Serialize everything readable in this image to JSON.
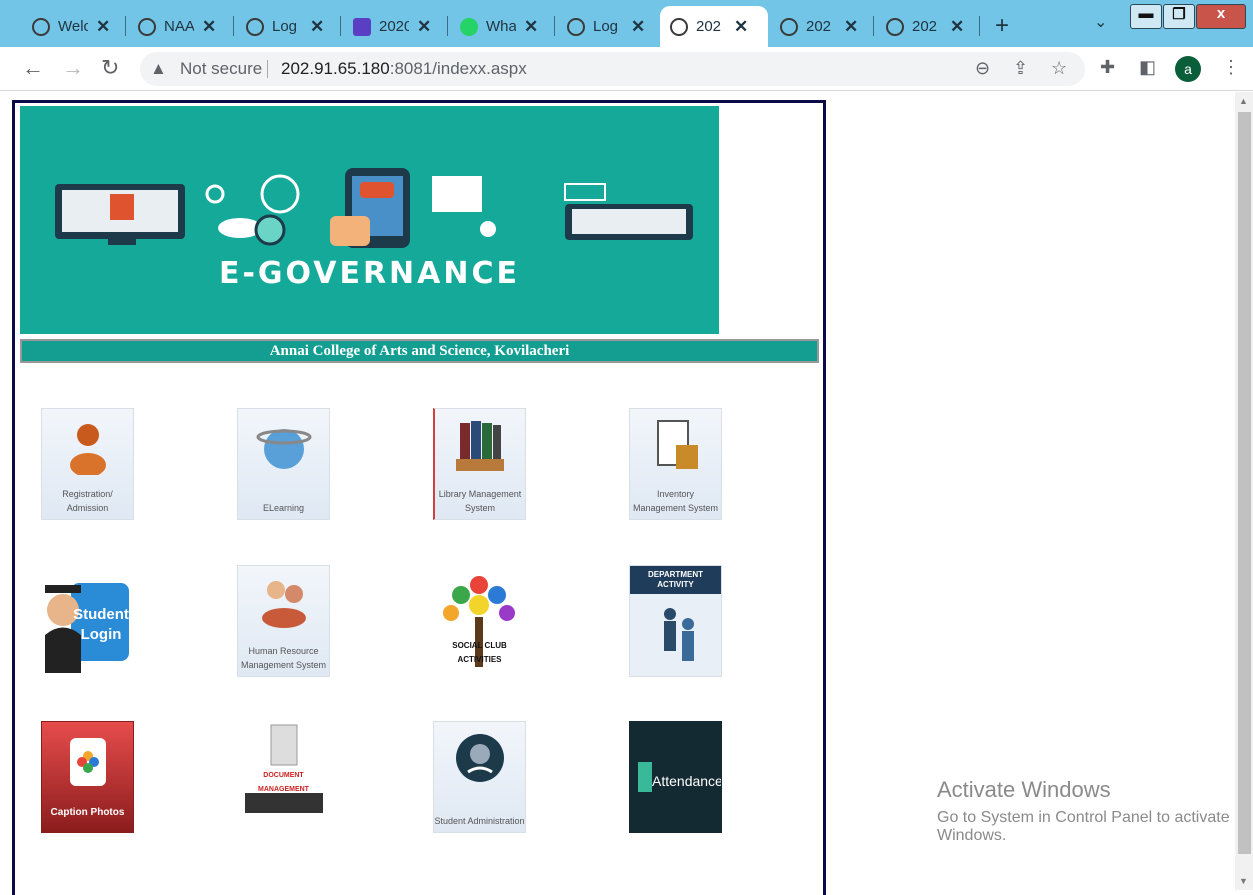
{
  "tabs": [
    {
      "title": "Welc",
      "icon": "globe-icon",
      "active": false
    },
    {
      "title": "NAA",
      "icon": "globe-icon",
      "active": false
    },
    {
      "title": "Log",
      "icon": "globe-icon",
      "active": false
    },
    {
      "title": "2020",
      "icon": "form-icon",
      "active": false
    },
    {
      "title": "Wha",
      "icon": "whatsapp-icon",
      "active": false
    },
    {
      "title": "Log",
      "icon": "globe-icon",
      "active": false
    },
    {
      "title": "202",
      "icon": "globe-icon",
      "active": true
    },
    {
      "title": "202",
      "icon": "globe-icon",
      "active": false
    },
    {
      "title": "202",
      "icon": "globe-icon",
      "active": false
    }
  ],
  "window": {
    "minimize": "▬",
    "restore": "❐",
    "close": "x"
  },
  "toolbar": {
    "not_secure": "Not secure",
    "url_host": "202.91.65.180",
    "url_rest": ":8081/indexx.aspx",
    "avatar_letter": "a"
  },
  "banner": {
    "title": "E-GOVERNANCE"
  },
  "college_name": "Annai College of Arts and Science, Kovilacheri",
  "tiles": [
    {
      "label": "Registration/ Admission"
    },
    {
      "label": "ELearning"
    },
    {
      "label": "Library Management System"
    },
    {
      "label": "Inventory Management System"
    },
    {
      "label": "Student Login"
    },
    {
      "label": "Human Resource Management System"
    },
    {
      "label": "SOCIAL CLUB ACTIVITIES"
    },
    {
      "label": "DEPARTMENT ACTIVITY"
    },
    {
      "label": "Caption Photos"
    },
    {
      "label": "DOCUMENT MANAGEMENT"
    },
    {
      "label": "Student Administration"
    },
    {
      "label": "Attendance"
    }
  ],
  "watermark": {
    "line1": "Activate Windows",
    "line2": "Go to System in Control Panel to activate Windows."
  },
  "colors": {
    "tabbar": "#72c5e6",
    "banner": "#15a99a",
    "frame": "#0b0b4a"
  }
}
